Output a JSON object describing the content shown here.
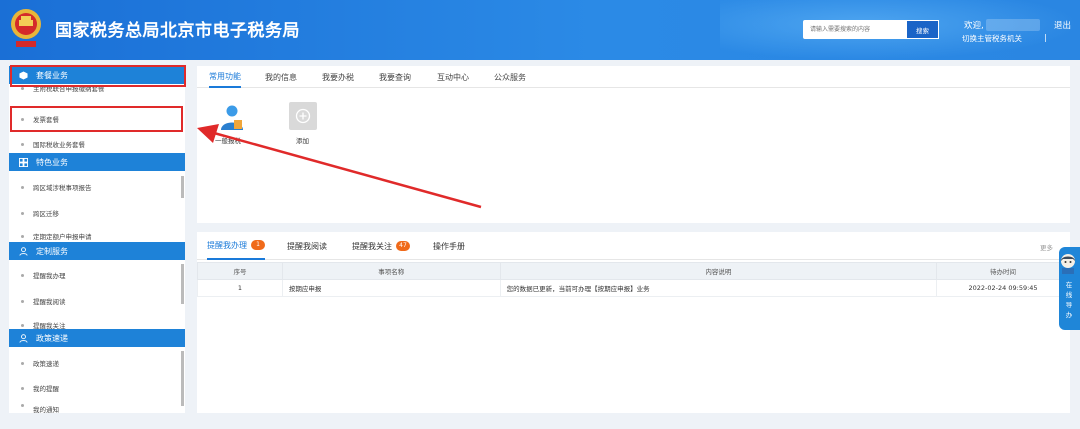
{
  "header": {
    "title": "国家税务总局北京市电子税务局",
    "search_placeholder": "请输入需要搜索的内容",
    "search_button": "搜索",
    "welcome": "欢迎,",
    "switch_auth": "切换主管税务机关",
    "divider": "|",
    "logout": "退出",
    "emblem_icon": "tax-emblem-icon"
  },
  "sidebar": {
    "sections": [
      {
        "title": "套餐业务",
        "icon": "cube-icon",
        "items": [
          "主附税联合申报缴纳套餐",
          "发票套餐",
          "国际税收业务套餐"
        ]
      },
      {
        "title": "特色业务",
        "icon": "grid-icon",
        "items": [
          "跨区域涉税事项报告",
          "跨区迁移",
          "定期定额户申报申请"
        ]
      },
      {
        "title": "定制服务",
        "icon": "user-icon",
        "items": [
          "提醒我办理",
          "提醒我阅读",
          "提醒我关注"
        ]
      },
      {
        "title": "政策速递",
        "icon": "user-icon",
        "items": [
          "政策速递",
          "我的提醒",
          "我的通知"
        ]
      }
    ]
  },
  "top_tabs": [
    "常用功能",
    "我的信息",
    "我要办税",
    "我要查询",
    "互动中心",
    "公众服务"
  ],
  "tiles": [
    {
      "label": "一般报税",
      "icon": "person-icon"
    },
    {
      "label": "添加",
      "icon": "plus-circle-icon"
    }
  ],
  "bottom_tabs": [
    {
      "label": "提醒我办理",
      "badge": "1"
    },
    {
      "label": "提醒我阅读",
      "badge": ""
    },
    {
      "label": "提醒我关注",
      "badge": "47"
    },
    {
      "label": "操作手册",
      "badge": ""
    }
  ],
  "more": "更多",
  "table": {
    "headers": [
      "序号",
      "事项名称",
      "内容说明",
      "待办时间"
    ],
    "rows": [
      [
        "1",
        "按期应申报",
        "您的数据已更新，当前可办理【按期应申报】业务",
        "2022-02-24 09:59:45"
      ]
    ]
  },
  "side_nav": {
    "text": "在线导办",
    "icon": "robot-avatar-icon"
  },
  "colors": {
    "header_blue": "#1a6fd6",
    "sidebar_header": "#1e82d8",
    "active_tab": "#1a7ad9",
    "badge_orange": "#f06a1a",
    "annotation_red": "#e02a2a"
  }
}
